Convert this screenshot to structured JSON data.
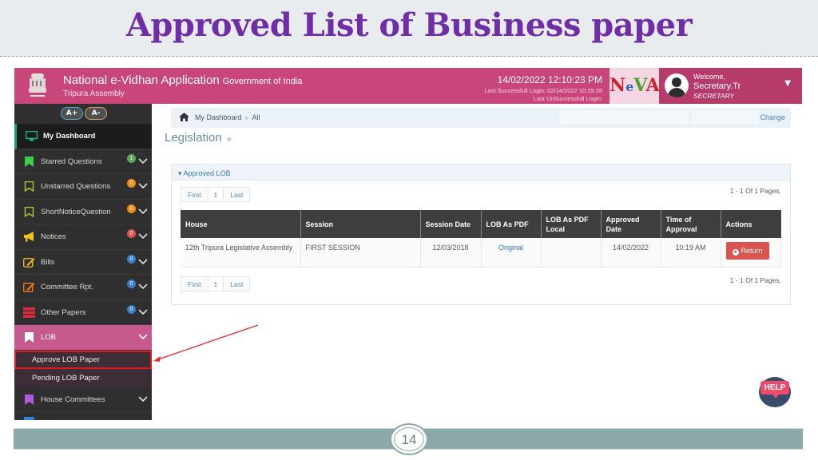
{
  "slide": {
    "title": "Approved List of Business paper",
    "page_number": "14"
  },
  "app": {
    "title": "National e-Vidhan Application",
    "title_suffix": "Government of India",
    "subtitle": "Tripura Assembly",
    "datetime": "14/02/2022 12:10:23 PM",
    "last_success_login": "Last Successfull Login: 02/14/2022 10:19:28",
    "last_unsuccess_login": "Last UnSuccessfull Login:",
    "logo_letters": [
      "N",
      "e",
      "V",
      "A"
    ],
    "user": {
      "welcome": "Welcome,",
      "name": "Secretary.Tr",
      "role": "SECRETARY"
    },
    "colors": {
      "topbar": "#c84679",
      "sidebar": "#2f2f2f",
      "lob_active": "#c65a8f",
      "return_button": "#d9534f",
      "slide_title": "#6f2da8"
    }
  },
  "font_buttons": {
    "increase": "A+",
    "decrease": "A-"
  },
  "sidebar": {
    "items": [
      {
        "label": "My Dashboard",
        "icon": "monitor-icon"
      },
      {
        "label": "Starred Questions",
        "icon": "bookmark-filled-icon",
        "badge": "1",
        "badge_color": "#5ba85b"
      },
      {
        "label": "Unstarred Questions",
        "icon": "bookmark-outline-icon",
        "badge": "0",
        "badge_color": "#ef8c12"
      },
      {
        "label": "ShortNoticeQuestion",
        "icon": "bookmark-outline-icon",
        "badge": "0",
        "badge_color": "#ef8c12"
      },
      {
        "label": "Notices",
        "icon": "megaphone-icon",
        "badge": "0",
        "badge_color": "#d9534f"
      },
      {
        "label": "Bills",
        "icon": "edit-icon",
        "badge": "0",
        "badge_color": "#3a7fc9"
      },
      {
        "label": "Committee Rpt.",
        "icon": "edit-icon",
        "badge": "0",
        "badge_color": "#3a7fc9"
      },
      {
        "label": "Other Papers",
        "icon": "server-icon",
        "badge": "0",
        "badge_color": "#3a7fc9"
      },
      {
        "label": "LOB",
        "icon": "bookmark-icon"
      },
      {
        "label": "House Committees",
        "icon": "bookmark-icon"
      }
    ],
    "lob_subitems": [
      {
        "label": "Approve LOB Paper"
      },
      {
        "label": "Pending LOB Paper"
      }
    ]
  },
  "breadcrumb": {
    "items": [
      "My Dashboard",
      "All"
    ],
    "change_label": "Change"
  },
  "page_heading": "Legislation",
  "panel": {
    "title": "Approved LOB",
    "pager": {
      "first": "First",
      "page": "1",
      "last": "Last"
    },
    "pages_info": "1 - 1 Of 1 Pages.",
    "columns": [
      "House",
      "Session",
      "Session Date",
      "LOB As PDF",
      "LOB As PDF Local",
      "Approved Date",
      "Time of Approval",
      "Actions"
    ],
    "rows": [
      {
        "house": "12th Tripura Legislative Assembly",
        "session": "FIRST SESSION",
        "session_date": "12/03/2018",
        "lob_pdf": "Original",
        "lob_pdf_local": "",
        "approved_date": "14/02/2022",
        "time_of_approval": "10:19 AM",
        "action": "Return"
      }
    ]
  },
  "help": {
    "label": "HELP"
  }
}
